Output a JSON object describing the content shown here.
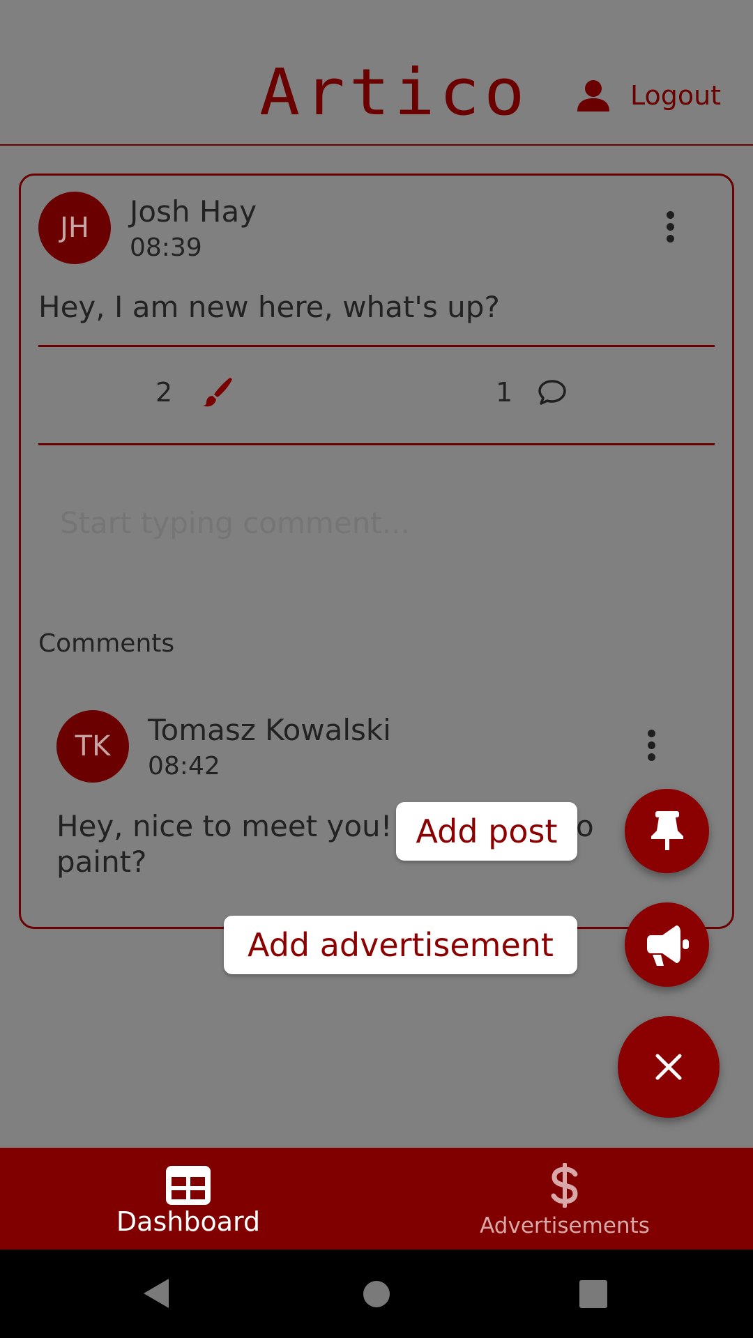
{
  "header": {
    "logo_text": "Artico",
    "logout_label": "Logout",
    "user_icon": "person-icon"
  },
  "post": {
    "avatar_initials": "JH",
    "author": "Josh Hay",
    "time": "08:39",
    "text": "Hey, I am new here, what's up?",
    "likes_count": "2",
    "like_icon": "paintbrush-icon",
    "comments_count": "1",
    "comment_icon": "speech-bubble-icon",
    "menu_icon": "kebab-menu-icon"
  },
  "comment_input": {
    "placeholder": "Start typing comment..."
  },
  "comments": {
    "heading": "Comments",
    "items": [
      {
        "avatar_initials": "TK",
        "author": "Tomasz Kowalski",
        "time": "08:42",
        "text_line1": "Hey, nice to meet you! ",
        "text_hidden_tail": "o",
        "text_line2": "paint?"
      }
    ]
  },
  "speed_dial": {
    "add_post_label": "Add post",
    "add_post_icon": "pushpin-icon",
    "add_ad_label": "Add advertisement",
    "add_ad_icon": "megaphone-icon",
    "close_icon": "close-icon"
  },
  "bottom_nav": {
    "items": [
      {
        "label": "Dashboard",
        "icon": "table-icon",
        "active": true
      },
      {
        "label": "Advertisements",
        "icon": "dollar-icon",
        "active": false
      }
    ]
  },
  "system_nav": {
    "back_icon": "back-triangle-icon",
    "home_icon": "home-circle-icon",
    "recents_icon": "recents-square-icon"
  },
  "colors": {
    "accent": "#8b0000",
    "overlay_background": "#808080"
  }
}
